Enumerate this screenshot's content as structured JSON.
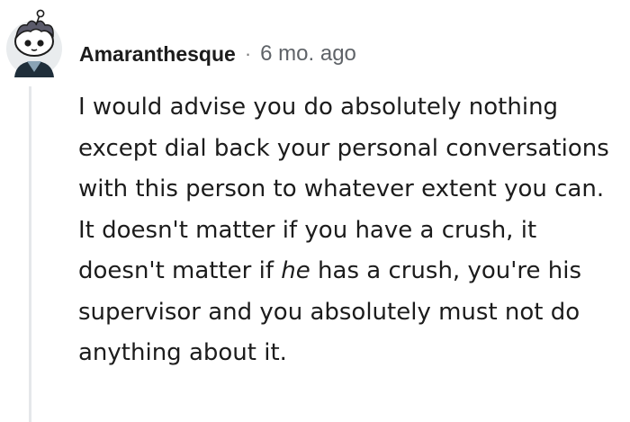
{
  "comment": {
    "author": "Amaranthesque",
    "separator": "·",
    "timestamp": "6 mo. ago",
    "avatar_icon": "snoo-avatar-icon",
    "body": {
      "part1": "I would advise you do absolutely nothing except dial back your personal conversations with this person to whatever extent you can. It doesn't matter if you have a crush, it doesn't matter if ",
      "emphasis": "he",
      "part2": " has a crush, you're his supervisor and you absolutely must not do anything about it."
    }
  },
  "colors": {
    "text": "#1c1c1c",
    "meta": "#5f6368",
    "thread_line": "#e5e7ea",
    "background": "#ffffff"
  }
}
